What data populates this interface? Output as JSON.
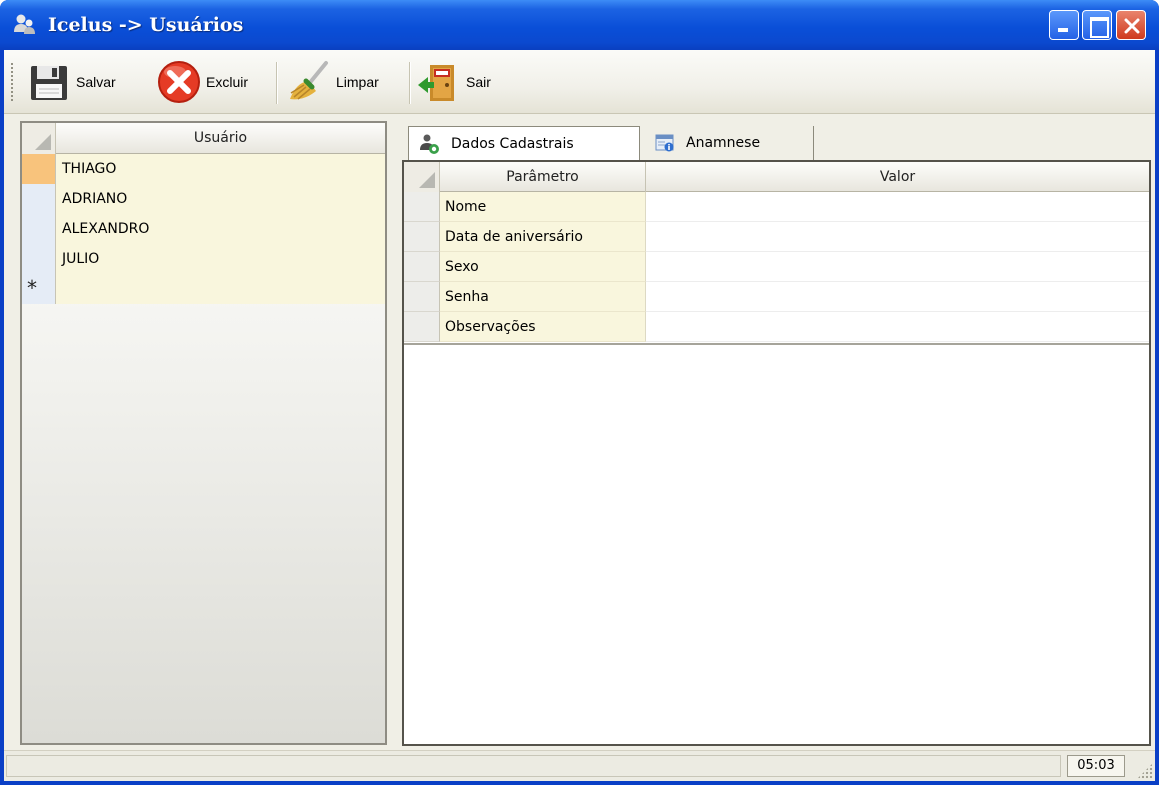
{
  "window": {
    "title": "Icelus -> Usuários"
  },
  "toolbar": {
    "save_label": "Salvar",
    "delete_label": "Excluir",
    "clear_label": "Limpar",
    "exit_label": "Sair"
  },
  "users_grid": {
    "header": "Usuário",
    "rows": [
      "THIAGO",
      "ADRIANO",
      "ALEXANDRO",
      "JULIO"
    ],
    "new_row_marker": "*"
  },
  "tabs": [
    {
      "label": "Dados Cadastrais"
    },
    {
      "label": "Anamnese"
    }
  ],
  "property_grid": {
    "header_param": "Parâmetro",
    "header_value": "Valor",
    "rows": [
      {
        "param": "Nome",
        "value": ""
      },
      {
        "param": "Data de aniversário",
        "value": ""
      },
      {
        "param": "Sexo",
        "value": ""
      },
      {
        "param": "Senha",
        "value": ""
      },
      {
        "param": "Observações",
        "value": ""
      }
    ]
  },
  "statusbar": {
    "clock": "05:03"
  },
  "colors": {
    "titlebar": "#0a4fd8",
    "selected_row_header": "#f8c37c",
    "cell_background": "#f9f6dd",
    "close_button": "#cf3b1f"
  }
}
